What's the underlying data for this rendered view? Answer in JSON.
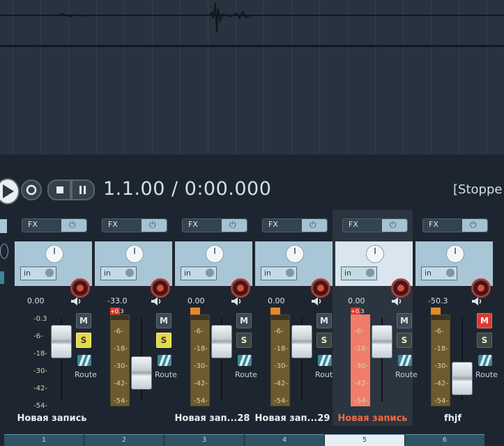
{
  "transport": {
    "position": "1.1.00 / 0:00.000",
    "state": "[Stoppe",
    "buttons": [
      "play",
      "record",
      "stop",
      "pause"
    ]
  },
  "tracks": [
    {
      "name": "Новая запись",
      "volume": "0.00",
      "clip": "",
      "mute": false,
      "solo": true,
      "number": "1",
      "selected": false,
      "name_hot": false,
      "meter": [
        "-0.3",
        "-6-",
        "-18-",
        "-30-",
        "-42-",
        "-54-"
      ],
      "meter_level": 0
    },
    {
      "name": "",
      "volume": "-33.0",
      "clip": "+0.3",
      "mute": false,
      "solo": true,
      "number": "2",
      "selected": false,
      "name_hot": false,
      "meter": [
        "-6-",
        "-18-",
        "-30-",
        "-42-",
        "-54-"
      ],
      "meter_level": 0.95
    },
    {
      "name": "Новая зап...28",
      "volume": "0.00",
      "clip": "",
      "mute": false,
      "solo": false,
      "number": "3",
      "selected": false,
      "name_hot": false,
      "meter": [
        "-6-",
        "-18-",
        "-30-",
        "-42-",
        "-54-"
      ],
      "meter_level": 0.95
    },
    {
      "name": "Новая зап...29",
      "volume": "0.00",
      "clip": "",
      "mute": false,
      "solo": false,
      "number": "4",
      "selected": false,
      "name_hot": false,
      "meter": [
        "-6-",
        "-18-",
        "-30-",
        "-42-",
        "-54-"
      ],
      "meter_level": 0.95
    },
    {
      "name": "Новая запись",
      "volume": "0.00",
      "clip": "+0.3",
      "mute": false,
      "solo": false,
      "number": "5",
      "selected": true,
      "name_hot": true,
      "meter": [
        "-6-",
        "-18-",
        "-30-",
        "-42-",
        "-54-"
      ],
      "meter_level": 1.0
    },
    {
      "name": "fhjf",
      "volume": "-50.3",
      "clip": "",
      "mute": true,
      "solo": false,
      "number": "6",
      "selected": false,
      "name_hot": false,
      "meter": [
        "-6-",
        "-18-",
        "-30-",
        "-42-",
        "-54-"
      ],
      "meter_level": 0.95
    }
  ],
  "labels": {
    "fx": "FX",
    "in": "in",
    "mute": "M",
    "solo": "S",
    "route": "Route"
  },
  "colors": {
    "accent": "#a9c6d6",
    "record": "#e04b3e",
    "solo_on": "#e3d94a",
    "mute_on": "#d93b30",
    "selected_name": "#f26a3e"
  },
  "icons": {
    "play": "play-icon",
    "record": "record-loop-icon",
    "stop": "stop-icon",
    "pause": "pause-icon",
    "power": "power-icon",
    "speaker": "speaker-icon",
    "route": "route-icon"
  }
}
